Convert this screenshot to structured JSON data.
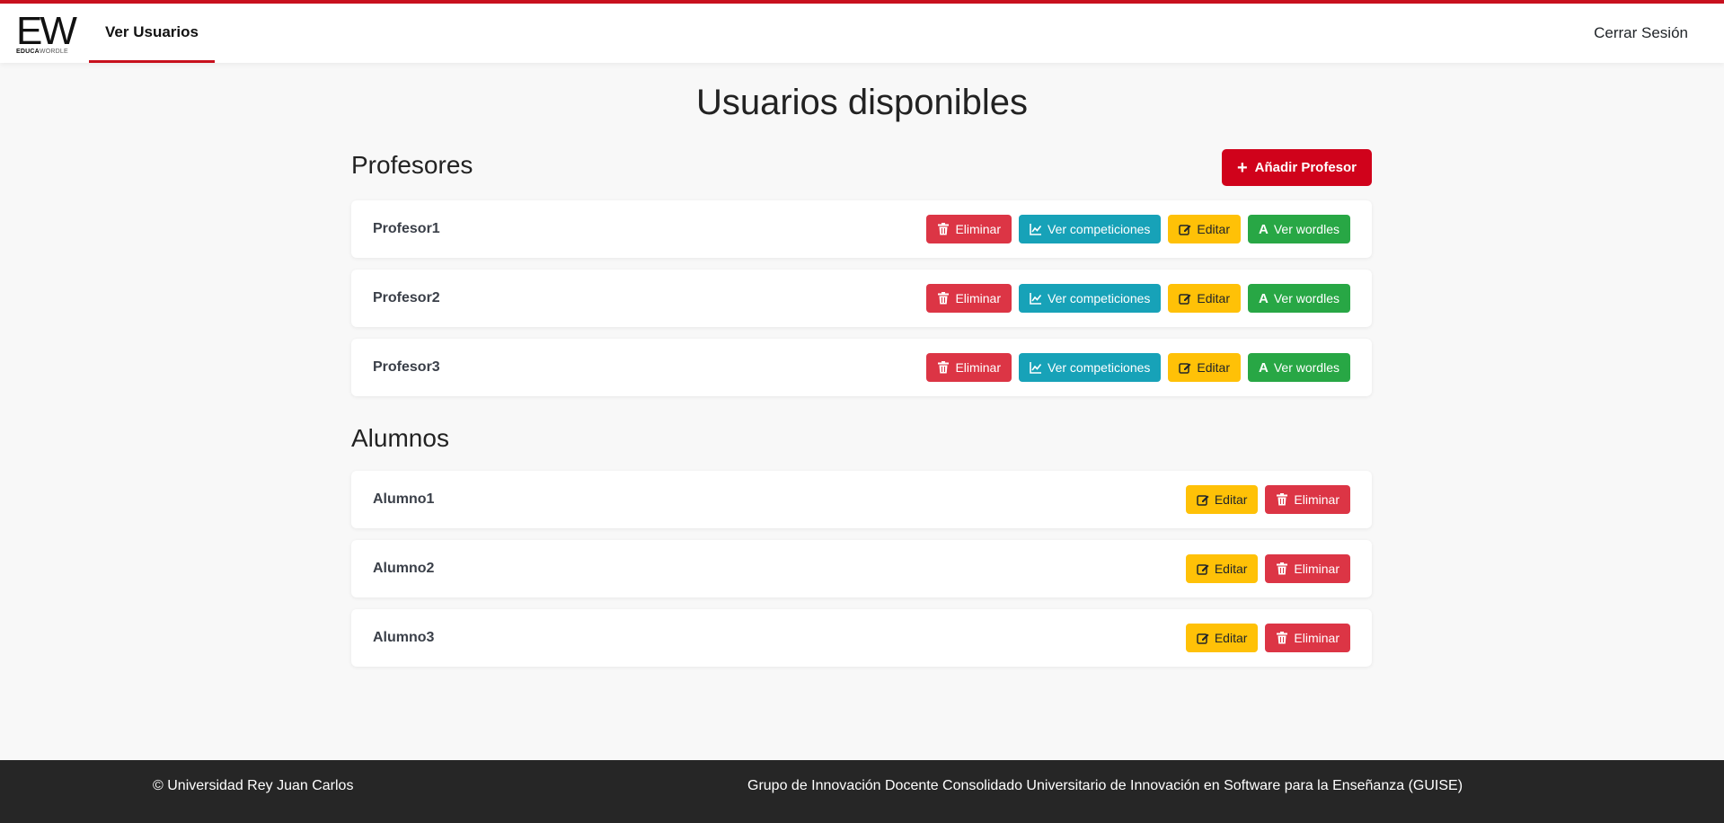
{
  "header": {
    "logo_mark": "EW",
    "logo_bold": "EDUCA",
    "logo_light": "WORDLE",
    "nav_tab": "Ver Usuarios",
    "logout": "Cerrar Sesión"
  },
  "main": {
    "title": "Usuarios disponibles",
    "profesores": {
      "title": "Profesores",
      "add_button": "Añadir Profesor",
      "items": [
        {
          "name": "Profesor1"
        },
        {
          "name": "Profesor2"
        },
        {
          "name": "Profesor3"
        }
      ],
      "actions": {
        "delete": "Eliminar",
        "competitions": "Ver competiciones",
        "edit": "Editar",
        "wordles": "Ver wordles"
      }
    },
    "alumnos": {
      "title": "Alumnos",
      "items": [
        {
          "name": "Alumno1"
        },
        {
          "name": "Alumno2"
        },
        {
          "name": "Alumno3"
        }
      ],
      "actions": {
        "edit": "Editar",
        "delete": "Eliminar"
      }
    }
  },
  "footer": {
    "left": "© Universidad Rey Juan Carlos",
    "right": "Grupo de Innovación Docente Consolidado Universitario de Innovación en Software para la Enseñanza (GUISE)"
  },
  "colors": {
    "brand_red": "#c8101e",
    "danger": "#dc3545",
    "info": "#17a2b8",
    "warning": "#ffc107",
    "success": "#28a745",
    "footer_bg": "#262626"
  },
  "icons": {
    "delete": "trash-icon",
    "competitions": "chart-line-icon",
    "edit": "edit-icon",
    "wordles": "font-a-icon",
    "add": "plus-icon"
  }
}
